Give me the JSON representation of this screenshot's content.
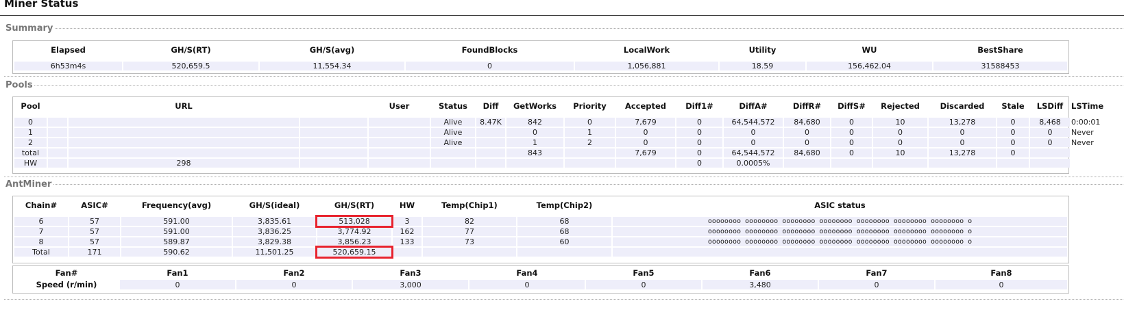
{
  "page_title": "Miner Status",
  "summary": {
    "legend": "Summary",
    "headers": [
      "Elapsed",
      "GH/S(RT)",
      "GH/S(avg)",
      "FoundBlocks",
      "LocalWork",
      "Utility",
      "WU",
      "BestShare"
    ],
    "values": [
      "6h53m4s",
      "520,659.5",
      "11,554.34",
      "0",
      "1,056,881",
      "18.59",
      "156,462.04",
      "31588453"
    ]
  },
  "pools": {
    "legend": "Pools",
    "headers": [
      "Pool",
      "",
      "URL",
      "",
      "User",
      "Status",
      "Diff",
      "GetWorks",
      "Priority",
      "Accepted",
      "Diff1#",
      "DiffA#",
      "DiffR#",
      "DiffS#",
      "Rejected",
      "Discarded",
      "Stale",
      "LSDiff",
      "LSTime"
    ],
    "rows": [
      [
        "0",
        "",
        "",
        "",
        "",
        "Alive",
        "8.47K",
        "842",
        "0",
        "7,679",
        "0",
        "64,544,572",
        "84,680",
        "0",
        "10",
        "13,278",
        "0",
        "8,468",
        "0:00:01"
      ],
      [
        "1",
        "",
        "",
        "",
        "",
        "Alive",
        "",
        "0",
        "1",
        "0",
        "0",
        "0",
        "0",
        "0",
        "0",
        "0",
        "0",
        "0",
        "Never"
      ],
      [
        "2",
        "",
        "",
        "",
        "",
        "Alive",
        "",
        "1",
        "2",
        "0",
        "0",
        "0",
        "0",
        "0",
        "0",
        "0",
        "0",
        "0",
        "Never"
      ],
      [
        "total",
        "",
        "",
        "",
        "",
        "",
        "",
        "843",
        "",
        "7,679",
        "0",
        "64,544,572",
        "84,680",
        "0",
        "10",
        "13,278",
        "0",
        "",
        ""
      ],
      [
        "HW",
        "",
        "298",
        "",
        "",
        "",
        "",
        "",
        "",
        "",
        "0",
        "0.0005%",
        "",
        "",
        "",
        "",
        "",
        "",
        ""
      ]
    ]
  },
  "antminer": {
    "legend": "AntMiner",
    "headers": [
      "Chain#",
      "ASIC#",
      "Frequency(avg)",
      "GH/S(ideal)",
      "GH/S(RT)",
      "HW",
      "Temp(Chip1)",
      "Temp(Chip2)",
      "ASIC status"
    ],
    "rows": [
      [
        "6",
        "57",
        "591.00",
        "3,835.61",
        "513,028",
        "3",
        "82",
        "68",
        "oooooooo oooooooo oooooooo oooooooo oooooooo oooooooo oooooooo o"
      ],
      [
        "7",
        "57",
        "591.00",
        "3,836.25",
        "3,774.92",
        "162",
        "77",
        "68",
        "oooooooo oooooooo oooooooo oooooooo oooooooo oooooooo oooooooo o"
      ],
      [
        "8",
        "57",
        "589.87",
        "3,829.38",
        "3,856.23",
        "133",
        "73",
        "60",
        "oooooooo oooooooo oooooooo oooooooo oooooooo oooooooo oooooooo o"
      ],
      [
        "Total",
        "171",
        "590.62",
        "11,501.25",
        "520,659.15",
        "",
        "",
        "",
        ""
      ]
    ],
    "fans": {
      "headers": [
        "Fan#",
        "Fan1",
        "Fan2",
        "Fan3",
        "Fan4",
        "Fan5",
        "Fan6",
        "Fan7",
        "Fan8"
      ],
      "row_label": "Speed (r/min)",
      "values": [
        "0",
        "0",
        "3,000",
        "0",
        "0",
        "3,480",
        "0",
        "0"
      ]
    }
  },
  "colors": {
    "highlight": "#e8232e",
    "cell_bg": "#eeeefa"
  }
}
